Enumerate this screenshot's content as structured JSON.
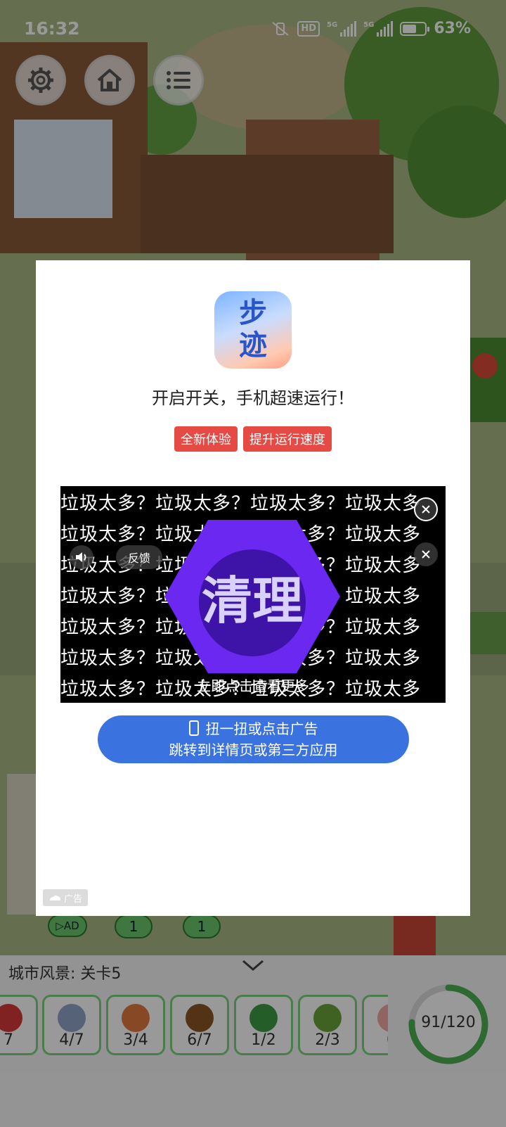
{
  "status_bar": {
    "time": "16:32",
    "hd": "HD",
    "net1": "5G",
    "net2": "5G",
    "battery": "63%",
    "battery_level": 0.63
  },
  "game": {
    "buttons": {
      "settings_icon": "gear-icon",
      "home_icon": "home-icon",
      "menu_icon": "list-icon"
    },
    "ad_pill": "AD",
    "pill_counts": [
      "1",
      "1"
    ],
    "level_label": "城市风景: 关卡5",
    "items": [
      {
        "icon": "rose-icon",
        "count": "7",
        "color": "#d83a3a"
      },
      {
        "icon": "food-tin-icon",
        "count": "4/7",
        "color": "#8ea4c8"
      },
      {
        "icon": "basketball-icon",
        "count": "3/4",
        "color": "#e27b3f"
      },
      {
        "icon": "acorn-icon",
        "count": "6/7",
        "color": "#8a5424"
      },
      {
        "icon": "clover-icon",
        "count": "1/2",
        "color": "#3f9b45"
      },
      {
        "icon": "avocado-icon",
        "count": "2/3",
        "color": "#6aa43a"
      },
      {
        "icon": "peach-icon",
        "count": "0",
        "color": "#f0a7a0"
      }
    ],
    "progress": {
      "text": "91/120",
      "value": 91,
      "max": 120,
      "color": "#4caf50"
    }
  },
  "ad_modal": {
    "app_icon_text": [
      "步",
      "迹"
    ],
    "headline": "开启开关，手机超速运行！",
    "tags": [
      "全新体验",
      "提升运行速度"
    ],
    "video": {
      "repeat_text": "垃圾太多？垃圾太多？垃圾太多？垃圾太多",
      "hex_text": "清理",
      "feedback_label": "反馈",
      "sound_icon": "speaker-icon",
      "close_icon": "close-icon",
      "caption": "立即点击查看更多"
    },
    "cta_line1": "扭一扭或点击广告",
    "cta_line2": "跳转到详情页或第三方应用",
    "ad_badge": "广告"
  }
}
